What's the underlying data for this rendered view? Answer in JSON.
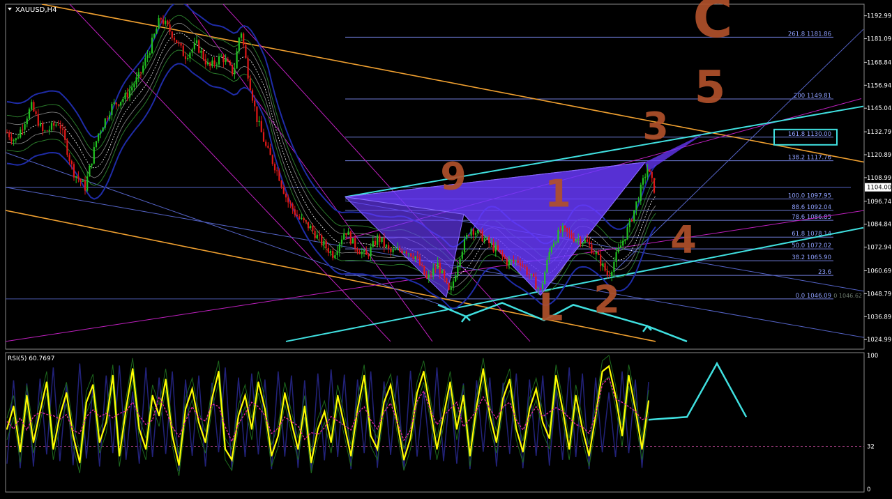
{
  "window": {
    "symbol_label": "XAUUSD,H4",
    "rsi_label": "RSI(5) 60.7697"
  },
  "colors": {
    "background": "#000000",
    "candle_up": "#22c222",
    "candle_down": "#e01818",
    "fib_lines": "#6f7dd9",
    "trend_orange": "#f0a030",
    "trend_magenta": "#c020c0",
    "channel_cyan": "#40e0e0",
    "pattern_fill": "#6a3aff",
    "handwriting": "#b0502a",
    "rsi_main": "#ffff00",
    "rsi_signal": "#e0289a",
    "bid_box": "#ffffff"
  },
  "chart_data": [
    {
      "type": "candlestick",
      "title": "XAUUSD,H4",
      "ylim": [
        1020.0,
        1199.0
      ],
      "price_axis": {
        "ticks": [
          "1192.99",
          "1181.09",
          "1168.84",
          "1156.94",
          "1145.04",
          "1132.79",
          "1120.89",
          "1108.99",
          "1096.74",
          "1084.84",
          "1072.94",
          "1060.69",
          "1048.79",
          "1036.89",
          "1024.99"
        ],
        "current_price": "1104.00"
      },
      "fibonacci_levels": [
        {
          "text": "261.8 1181.86",
          "price": 1181.86
        },
        {
          "text": "200 1149.81",
          "price": 1149.81
        },
        {
          "text": "161.8 1130.00",
          "price": 1130.0
        },
        {
          "text": "138.2 1117.76",
          "price": 1117.76
        },
        {
          "text": "100.0 1097.95",
          "price": 1097.95
        },
        {
          "text": "88.6 1092.04",
          "price": 1092.04
        },
        {
          "text": "78.6 1086.85",
          "price": 1086.85
        },
        {
          "text": "61.8 1078.14",
          "price": 1078.14
        },
        {
          "text": "50.0 1072.02",
          "price": 1072.02
        },
        {
          "text": "38.2 1065.90",
          "price": 1065.9
        },
        {
          "text": "23.6",
          "price": 1058.3
        },
        {
          "text": "0.0 1046.09",
          "price": 1046.09
        }
      ],
      "fib_extra_label": "0 1046.62",
      "price_path": [
        [
          0,
          1136
        ],
        [
          22,
          1128
        ],
        [
          45,
          1146
        ],
        [
          62,
          1132
        ],
        [
          85,
          1138
        ],
        [
          105,
          1112
        ],
        [
          122,
          1104
        ],
        [
          140,
          1131
        ],
        [
          160,
          1146
        ],
        [
          180,
          1151
        ],
        [
          200,
          1162
        ],
        [
          215,
          1176
        ],
        [
          230,
          1192
        ],
        [
          248,
          1183
        ],
        [
          265,
          1172
        ],
        [
          282,
          1178
        ],
        [
          300,
          1166
        ],
        [
          318,
          1172
        ],
        [
          335,
          1163
        ],
        [
          345,
          1187
        ],
        [
          356,
          1162
        ],
        [
          368,
          1140
        ],
        [
          382,
          1124
        ],
        [
          398,
          1112
        ],
        [
          412,
          1097
        ],
        [
          428,
          1088
        ],
        [
          445,
          1083
        ],
        [
          462,
          1075
        ],
        [
          478,
          1069
        ],
        [
          495,
          1082
        ],
        [
          508,
          1074
        ],
        [
          525,
          1068
        ],
        [
          542,
          1078
        ],
        [
          560,
          1070
        ],
        [
          580,
          1072
        ],
        [
          596,
          1068
        ],
        [
          612,
          1056
        ],
        [
          628,
          1064
        ],
        [
          645,
          1048
        ],
        [
          660,
          1070
        ],
        [
          675,
          1083
        ],
        [
          692,
          1078
        ],
        [
          710,
          1072
        ],
        [
          728,
          1065
        ],
        [
          745,
          1066
        ],
        [
          760,
          1058
        ],
        [
          775,
          1050
        ],
        [
          790,
          1074
        ],
        [
          805,
          1082
        ],
        [
          822,
          1078
        ],
        [
          840,
          1076
        ],
        [
          855,
          1069
        ],
        [
          872,
          1058
        ],
        [
          888,
          1072
        ],
        [
          902,
          1084
        ],
        [
          918,
          1102
        ],
        [
          928,
          1114
        ],
        [
          940,
          1101
        ]
      ],
      "harmonic_pattern": {
        "upper": [
          [
            495,
            1099
          ],
          [
            665,
            1090
          ],
          [
            775,
            1048
          ],
          [
            925,
            1117
          ]
        ],
        "lower": [
          [
            495,
            1099
          ],
          [
            640,
            1047
          ],
          [
            665,
            1090
          ],
          [
            775,
            1048
          ],
          [
            925,
            1117
          ]
        ]
      },
      "trend_lines": {
        "orange": [
          {
            "from": [
              60,
              1199
            ],
            "to": [
              1240,
              1117
            ]
          },
          {
            "from": [
              8,
              1092
            ],
            "to": [
              940,
              1024
            ]
          }
        ],
        "magenta": [
          {
            "from": [
              8,
              1024
            ],
            "to": [
              1240,
              1092
            ]
          },
          {
            "from": [
              100,
              1199
            ],
            "to": [
              560,
              1024
            ]
          },
          {
            "from": [
              268,
              1199
            ],
            "to": [
              620,
              1024
            ]
          },
          {
            "from": [
              320,
              1199
            ],
            "to": [
              760,
              1024
            ]
          },
          {
            "from": [
              495,
              1077
            ],
            "to": [
              1235,
              1150
            ]
          }
        ],
        "blue": [
          {
            "from": [
              8,
              1104
            ],
            "to": [
              1240,
              1026
            ]
          },
          {
            "from": [
              8,
              1122
            ],
            "to": [
              640,
              1042
            ]
          },
          {
            "from": [
              495,
              1097
            ],
            "to": [
              1240,
              1050
            ]
          },
          {
            "from": [
              880,
              1060
            ],
            "to": [
              1238,
              1186
            ]
          },
          {
            "from": [
              8,
              1104
            ],
            "to": [
              1220,
              1104
            ]
          }
        ],
        "cyan": [
          {
            "from": [
              495,
              1099
            ],
            "to": [
              1238,
              1146
            ]
          },
          {
            "from": [
              410,
              1024
            ],
            "to": [
              1238,
              1083
            ]
          }
        ]
      },
      "annotations": [
        {
          "text": "C",
          "x": 1022,
          "y": 1182
        },
        {
          "text": "5",
          "x": 1018,
          "y": 1148
        },
        {
          "text": "3",
          "x": 940,
          "y": 1129
        },
        {
          "text": "9",
          "x": 650,
          "y": 1103
        },
        {
          "text": "1",
          "x": 800,
          "y": 1094
        },
        {
          "text": "4",
          "x": 980,
          "y": 1070
        },
        {
          "text": "L",
          "x": 790,
          "y": 1035
        },
        {
          "text": "2",
          "x": 870,
          "y": 1039
        }
      ],
      "projection_path": [
        [
          628,
          1043
        ],
        [
          668,
          1037
        ],
        [
          720,
          1044
        ],
        [
          780,
          1035
        ],
        [
          822,
          1043
        ],
        [
          928,
          1032
        ],
        [
          985,
          1024
        ]
      ]
    },
    {
      "type": "line",
      "title": "RSI(5) 60.7697",
      "ylim": [
        0,
        100
      ],
      "axis_ticks": [
        "100",
        "32",
        "0"
      ],
      "level_line": 32,
      "series": [
        {
          "values": [
            45,
            62,
            28,
            70,
            35,
            58,
            80,
            30,
            55,
            72,
            40,
            20,
            65,
            78,
            35,
            50,
            85,
            25,
            60,
            90,
            45,
            30,
            70,
            55,
            82,
            40,
            18,
            60,
            75,
            50,
            35,
            68,
            88,
            30,
            22,
            55,
            70,
            45,
            80,
            60,
            25,
            40,
            72,
            50,
            30,
            62,
            20,
            45,
            58,
            35,
            70,
            48,
            25,
            60,
            85,
            40,
            30,
            65,
            78,
            50,
            22,
            38,
            72,
            88,
            60,
            30,
            55,
            80,
            45,
            70,
            25,
            62,
            90,
            55,
            35,
            68,
            82,
            45,
            28,
            60,
            75,
            50,
            38,
            85,
            60,
            30,
            70,
            45,
            25,
            55,
            88,
            92,
            70,
            40,
            85,
            60,
            30,
            66
          ]
        }
      ],
      "projection_path": [
        [
          930,
          52
        ],
        [
          985,
          54
        ],
        [
          1028,
          94
        ],
        [
          1070,
          54
        ]
      ]
    }
  ]
}
